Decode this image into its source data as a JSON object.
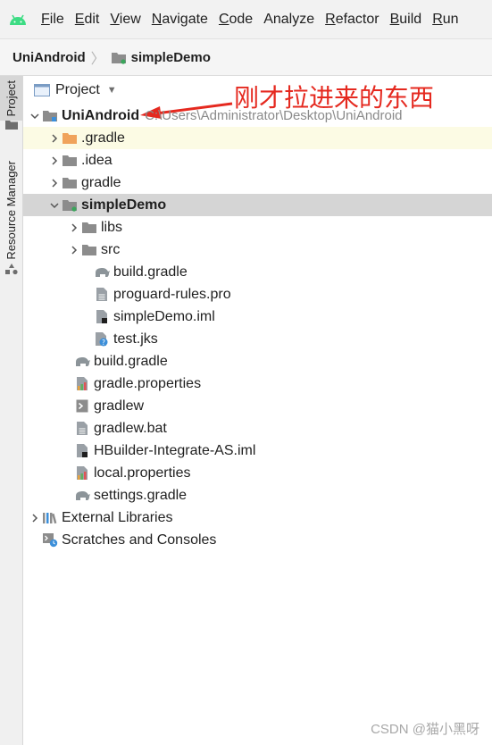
{
  "menubar": {
    "logo_icon": "android-icon",
    "items": [
      {
        "mn": "F",
        "rest": "ile"
      },
      {
        "mn": "E",
        "rest": "dit"
      },
      {
        "mn": "V",
        "rest": "iew"
      },
      {
        "mn": "N",
        "rest": "avigate"
      },
      {
        "mn": "C",
        "rest": "ode"
      },
      {
        "mn": "",
        "rest": "Analyze"
      },
      {
        "mn": "R",
        "rest": "efactor"
      },
      {
        "mn": "B",
        "rest": "uild"
      },
      {
        "mn": "R",
        "rest": "un"
      }
    ]
  },
  "breadcrumb": {
    "root": "UniAndroid",
    "module": "simpleDemo"
  },
  "side_tabs": {
    "project": "Project",
    "resource_manager": "Resource Manager"
  },
  "panel": {
    "view_label": "Project"
  },
  "tree": [
    {
      "label": "UniAndroid",
      "path": "C:\\Users\\Administrator\\Desktop\\UniAndroid",
      "icon": "module-folder-icon",
      "expanded": true,
      "bold": true
    },
    {
      "label": ".gradle",
      "icon": "orange-folder-icon",
      "expanded": false
    },
    {
      "label": ".idea",
      "icon": "folder-icon",
      "expanded": false
    },
    {
      "label": "gradle",
      "icon": "folder-icon",
      "expanded": false
    },
    {
      "label": "simpleDemo",
      "icon": "module-folder-icon",
      "expanded": true,
      "bold": true
    },
    {
      "label": "libs",
      "icon": "folder-icon",
      "expanded": false
    },
    {
      "label": "src",
      "icon": "folder-icon",
      "expanded": false
    },
    {
      "label": "build.gradle",
      "icon": "gradle-elephant-icon"
    },
    {
      "label": "proguard-rules.pro",
      "icon": "text-file-icon"
    },
    {
      "label": "simpleDemo.iml",
      "icon": "iml-file-icon"
    },
    {
      "label": "test.jks",
      "icon": "unknown-file-icon"
    },
    {
      "label": "build.gradle",
      "icon": "gradle-elephant-icon"
    },
    {
      "label": "gradle.properties",
      "icon": "properties-file-icon"
    },
    {
      "label": "gradlew",
      "icon": "script-file-icon"
    },
    {
      "label": "gradlew.bat",
      "icon": "text-file-icon"
    },
    {
      "label": "HBuilder-Integrate-AS.iml",
      "icon": "iml-file-icon"
    },
    {
      "label": "local.properties",
      "icon": "properties-file-icon"
    },
    {
      "label": "settings.gradle",
      "icon": "gradle-elephant-icon"
    },
    {
      "label": "External Libraries",
      "icon": "libraries-icon",
      "expanded": false
    },
    {
      "label": "Scratches and Consoles",
      "icon": "scratches-icon"
    }
  ],
  "annotation": {
    "text": "刚才拉进来的东西",
    "color": "#e5291f"
  },
  "watermark": "CSDN @猫小黑呀"
}
